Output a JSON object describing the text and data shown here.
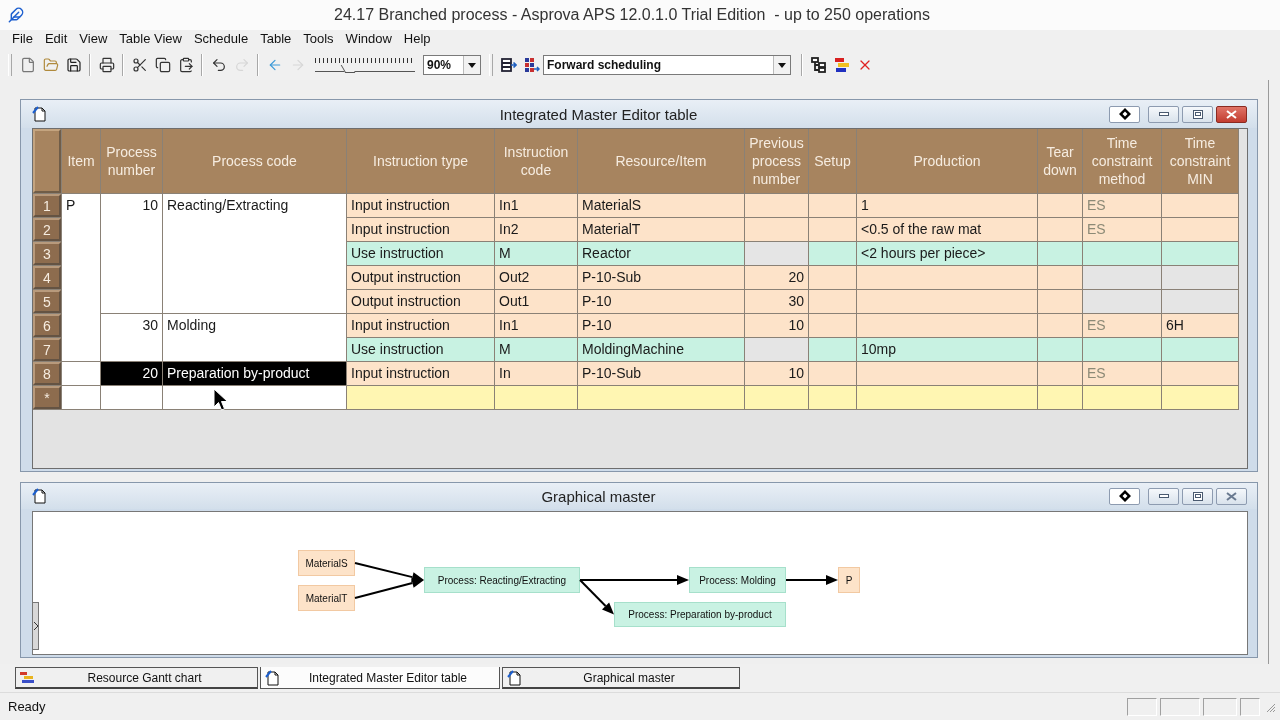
{
  "window": {
    "title": "24.17 Branched process - Asprova APS 12.0.1.0 Trial Edition  - up to 250 operations"
  },
  "menu": [
    "File",
    "Edit",
    "View",
    "Table View",
    "Schedule",
    "Table",
    "Tools",
    "Window",
    "Help"
  ],
  "toolbar": {
    "groups": [
      [
        {
          "kind": "new",
          "disabled": false
        },
        {
          "kind": "open",
          "disabled": false
        },
        {
          "kind": "save",
          "disabled": false
        }
      ],
      [
        {
          "kind": "print",
          "disabled": false
        }
      ],
      [
        {
          "kind": "cut",
          "disabled": false
        },
        {
          "kind": "copy",
          "disabled": false
        },
        {
          "kind": "paste",
          "disabled": false
        }
      ],
      [
        {
          "kind": "undo",
          "disabled": false
        },
        {
          "kind": "redo",
          "disabled": true
        }
      ],
      [
        {
          "kind": "back",
          "disabled": false
        },
        {
          "kind": "forward",
          "disabled": true
        }
      ]
    ],
    "zoom_slider": {
      "level": 0.3
    },
    "zoom": "90%",
    "schedule_buttons": [
      {
        "kind": "table_arrow",
        "disabled": false
      },
      {
        "kind": "grid_arrow",
        "disabled": false
      }
    ],
    "scheduling_mode": "Forward scheduling",
    "tool_buttons": [
      {
        "kind": "tree",
        "disabled": false
      },
      {
        "kind": "colors",
        "disabled": false
      },
      {
        "kind": "delete",
        "disabled": false
      }
    ]
  },
  "editor_window": {
    "title": "Integrated Master Editor table",
    "active": true,
    "table": {
      "columns": [
        "Item",
        "Process number",
        "Process code",
        "Instruction type",
        "Instruction code",
        "Resource/Item",
        "Previous process number",
        "Setup",
        "Production",
        "Tear down",
        "Time constraint method",
        "Time constraint MIN"
      ],
      "groups": [
        {
          "item": "P",
          "processes": [
            {
              "number": "10",
              "code": "Reacting/Extracting",
              "selected": false,
              "instructions": [
                {
                  "row": "1",
                  "kind": "input",
                  "type": "Input instruction",
                  "code": "In1",
                  "resource": "MaterialS",
                  "production": "1",
                  "time_method": "ES"
                },
                {
                  "row": "2",
                  "kind": "input",
                  "type": "Input instruction",
                  "code": "In2",
                  "resource": "MaterialT",
                  "production": "<0.5 of the raw mat",
                  "time_method": "ES"
                },
                {
                  "row": "3",
                  "kind": "use",
                  "type": "Use instruction",
                  "code": "M",
                  "resource": "Reactor",
                  "production": "<2 hours per piece>"
                },
                {
                  "row": "4",
                  "kind": "output",
                  "type": "Output instruction",
                  "code": "Out2",
                  "resource": "P-10-Sub",
                  "previous": "20"
                },
                {
                  "row": "5",
                  "kind": "output",
                  "type": "Output instruction",
                  "code": "Out1",
                  "resource": "P-10",
                  "previous": "30"
                }
              ]
            },
            {
              "number": "30",
              "code": "Molding",
              "selected": false,
              "instructions": [
                {
                  "row": "6",
                  "kind": "input",
                  "type": "Input instruction",
                  "code": "In1",
                  "resource": "P-10",
                  "previous": "10",
                  "time_method": "ES",
                  "time_min": "6H"
                },
                {
                  "row": "7",
                  "kind": "use",
                  "type": "Use instruction",
                  "code": "M",
                  "resource": "MoldingMachine",
                  "production": "10mp"
                }
              ]
            }
          ]
        },
        {
          "processes": [
            {
              "number": "20",
              "code": "Preparation by-product",
              "selected": true,
              "instructions": [
                {
                  "row": "8",
                  "kind": "input",
                  "type": "Input instruction",
                  "code": "In",
                  "resource": "P-10-Sub",
                  "previous": "10",
                  "time_method": "ES"
                }
              ]
            }
          ]
        }
      ],
      "new_row": {
        "marker": "*"
      }
    }
  },
  "graph_window": {
    "title": "Graphical master",
    "active": false,
    "flow": {
      "label": "Process: Reacting/Extracting",
      "kind": "process",
      "inputs": [
        {
          "label": "MaterialS",
          "kind": "item"
        },
        {
          "label": "MaterialT",
          "kind": "item"
        }
      ],
      "outputs": [
        {
          "label": "Process: Molding",
          "kind": "process",
          "outputs": [
            {
              "label": "P",
              "kind": "item"
            }
          ]
        },
        {
          "label": "Process: Preparation by-product",
          "kind": "process"
        }
      ]
    }
  },
  "tabs": [
    {
      "label": "Resource Gantt chart",
      "kind": "gantt",
      "selected": false
    },
    {
      "label": "Integrated Master Editor table",
      "kind": "document",
      "selected": true
    },
    {
      "label": "Graphical master",
      "kind": "document",
      "selected": false
    }
  ],
  "status_bar": {
    "text": "Ready"
  }
}
